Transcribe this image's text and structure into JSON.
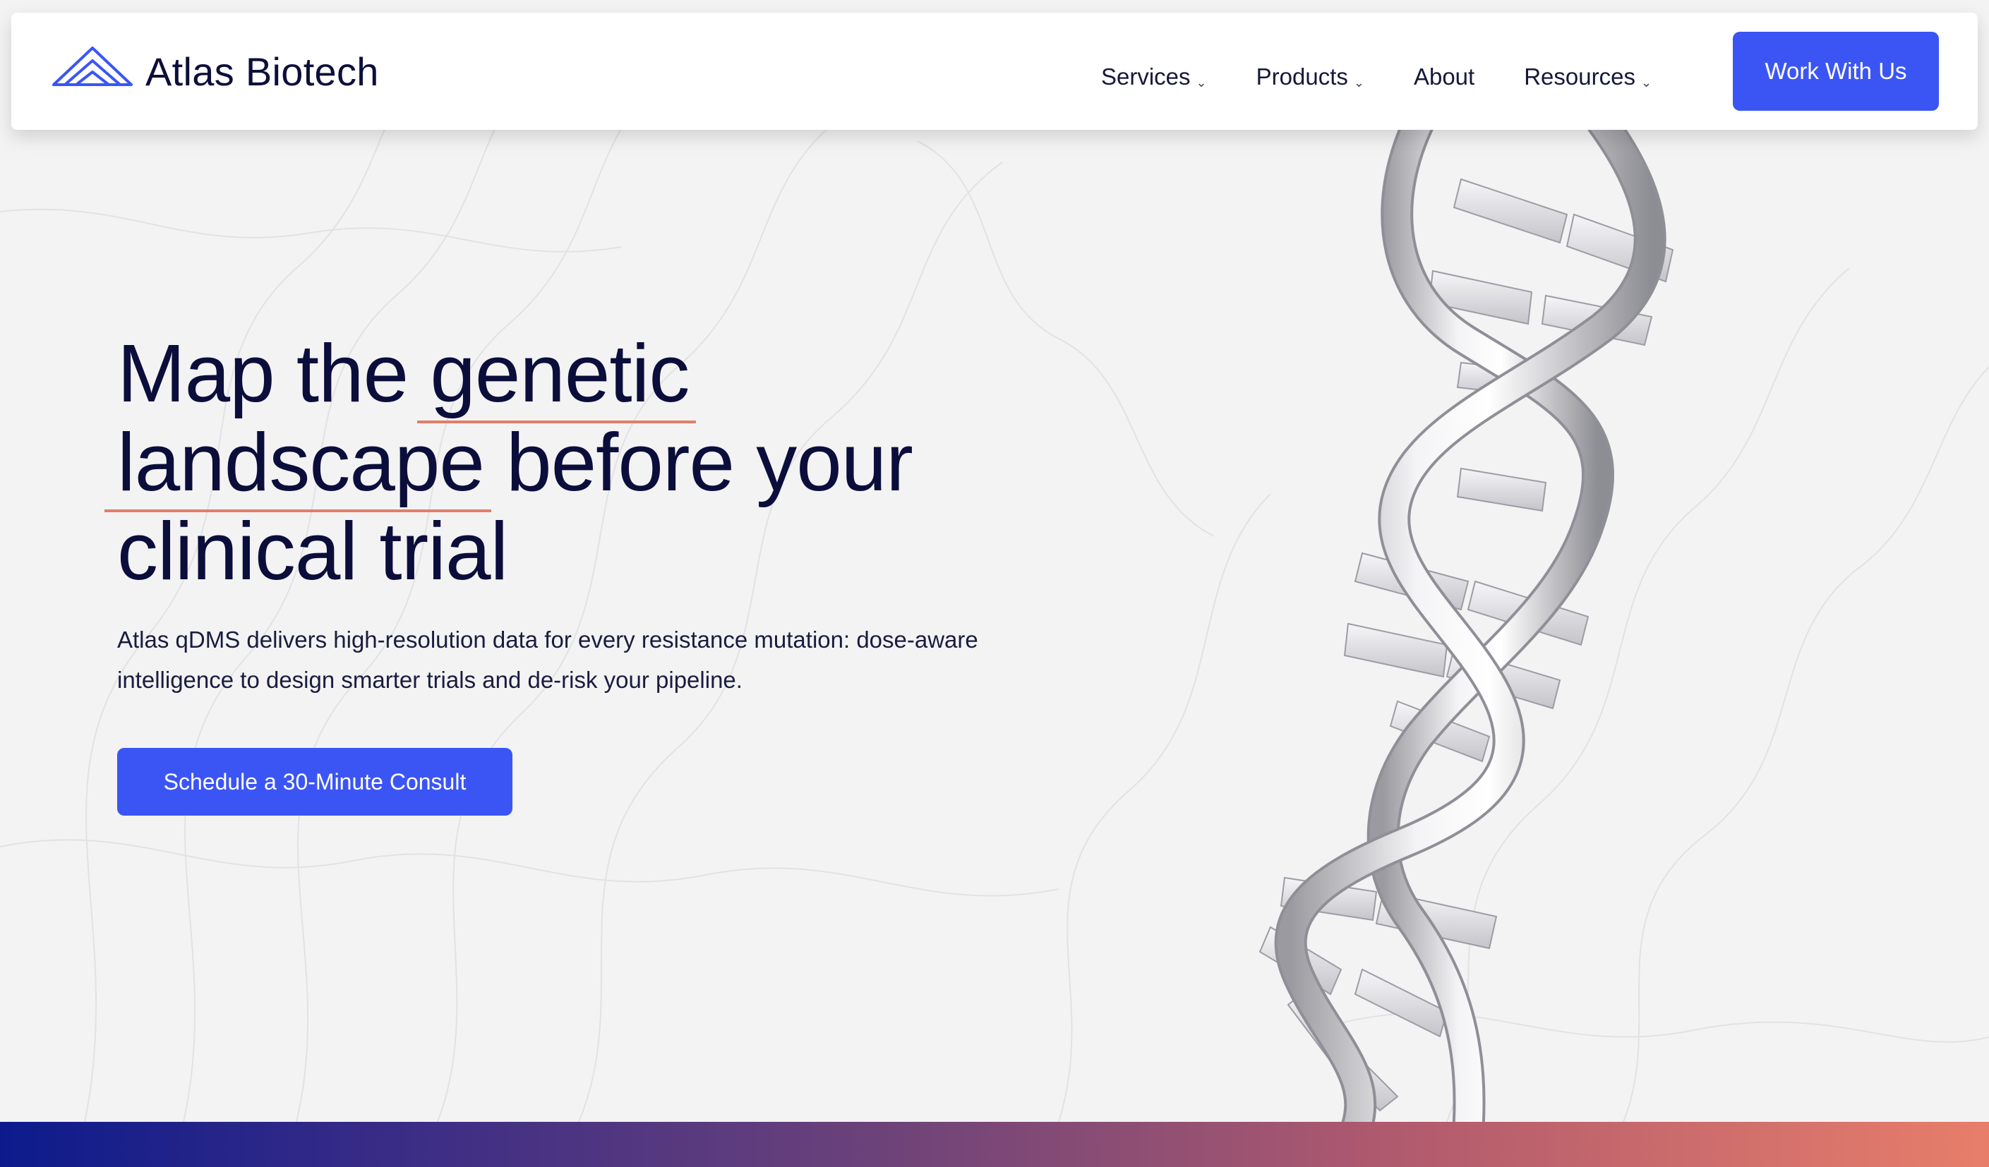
{
  "header": {
    "brand": "Atlas Biotech",
    "nav": [
      {
        "label": "Services",
        "has_dropdown": true
      },
      {
        "label": "Products",
        "has_dropdown": true
      },
      {
        "label": "About",
        "has_dropdown": false
      },
      {
        "label": "Resources",
        "has_dropdown": true
      }
    ],
    "chevron": "⌄",
    "cta_label": "Work With Us"
  },
  "hero": {
    "title_line1_a": "Map the ",
    "title_line1_b": "genetic",
    "title_line2_a": "landscape",
    "title_line2_b": " before your",
    "title_line3": "clinical trial",
    "subtitle_line1": "Atlas qDMS delivers high-resolution data for every resistance mutation: dose-aware",
    "subtitle_line2": "intelligence to design smarter trials and de-risk your pipeline.",
    "cta_label": "Schedule a 30-Minute Consult"
  },
  "icons": {
    "logo": "triangle-logo-icon",
    "dropdown": "chevron-down-icon"
  },
  "colors": {
    "primary": "#3b55f5",
    "text": "#0b0e3b",
    "underline": "#e07f68",
    "background": "#f3f3f4",
    "gradient_start": "#0c1b8c",
    "gradient_end": "#e87e6a"
  }
}
